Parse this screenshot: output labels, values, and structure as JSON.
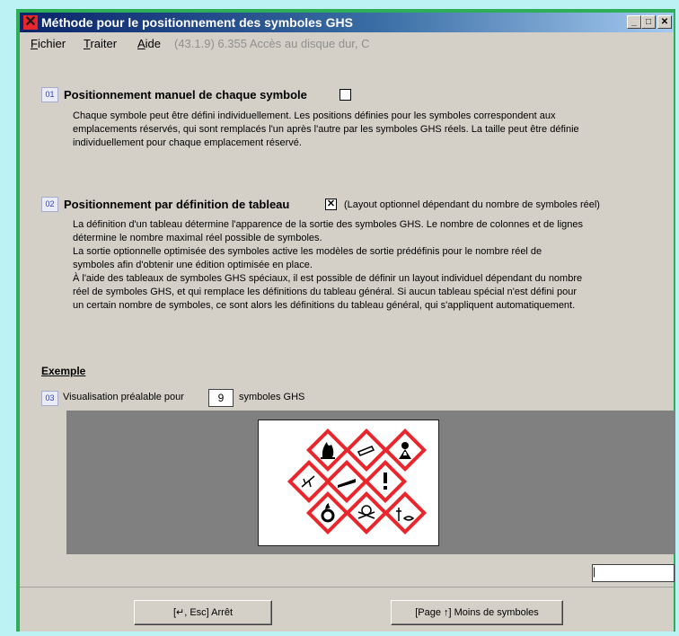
{
  "window": {
    "title": "Méthode pour le positionnement des symboles GHS"
  },
  "menu": {
    "fichier_first": "F",
    "fichier_rest": "ichier",
    "traiter_first": "T",
    "traiter_rest": "raiter",
    "aide_first": "A",
    "aide_rest": "ide",
    "status": "(43.1.9) 6.355 Accès au disque dur, C"
  },
  "section1": {
    "number": "01",
    "title": "Positionnement manuel de chaque symbole",
    "checked": "",
    "description": "Chaque symbole peut être défini individuellement. Les positions définies pour les symboles correspondent aux\nemplacements réservés, qui sont remplacés l'un après l'autre par les symboles GHS réels. La taille peut être définie\nindividuellement pour chaque emplacement réservé."
  },
  "section2": {
    "number": "02",
    "title": "Positionnement par définition de tableau",
    "checked": "✕",
    "note": "(Layout optionnel dépendant du nombre de symboles réel)",
    "description": "La définition d'un tableau détermine l'apparence de la sortie des symboles GHS. Le nombre de colonnes et de lignes\ndétermine le nombre maximal réel possible de symboles.\nLa sortie optionnelle optimisée des symboles active les modèles de sortie prédéfinis pour le nombre réel de\nsymboles afin d'obtenir une édition optimisée en place.\nÀ l'aide des tableaux de symboles GHS spéciaux, il est possible de définir un layout individuel dépendant du nombre\nréel de symboles GHS, et qui remplace les définitions du tableau général. Si aucun tableau spécial n'est défini pour\nun certain nombre de symboles, ce sont alors les définitions du tableau général, qui s'appliquent automatiquement."
  },
  "example": {
    "label": "Exemple",
    "number": "03",
    "preview_before": "Visualisation préalable pour",
    "count": "9",
    "preview_after": "symboles GHS",
    "pictograms": [
      "flame-icon",
      "gas-cylinder-icon",
      "health-hazard-icon",
      "environment-icon",
      "corrosion-icon",
      "exclamation-icon",
      "flame-over-circle-icon",
      "skull-icon",
      "fish-tree-icon"
    ],
    "colors": {
      "pictogram_border": "#e8262c"
    }
  },
  "small_field_value": "|",
  "buttons": {
    "stop": "[↵, Esc] Arrêt",
    "fewer": "[Page ↑] Moins de symboles"
  }
}
